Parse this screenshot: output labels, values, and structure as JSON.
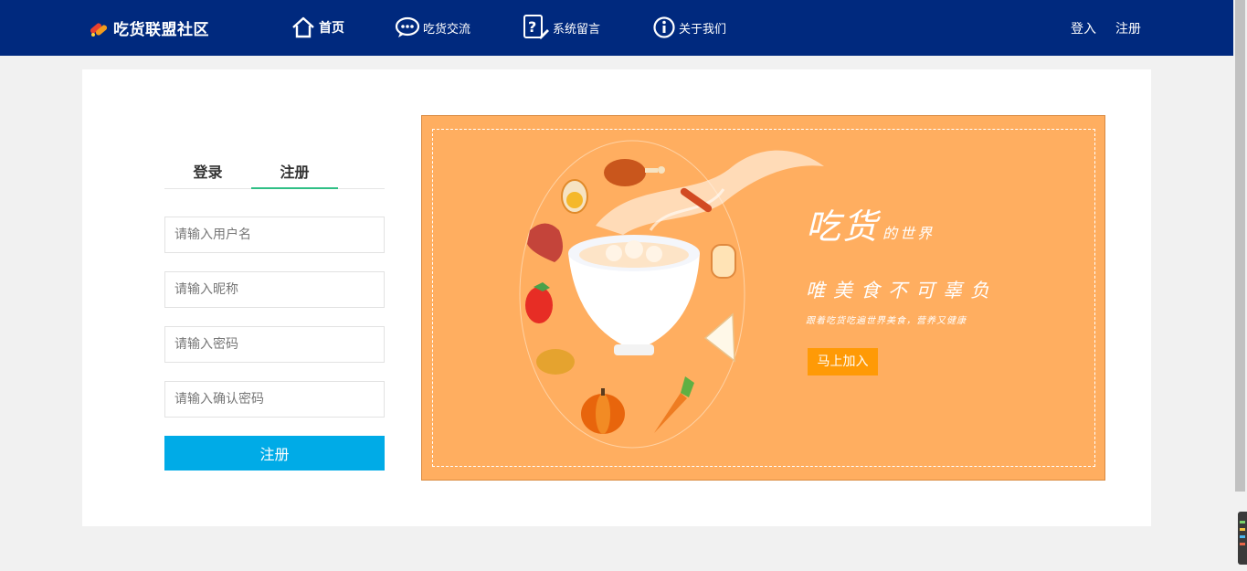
{
  "header": {
    "site_name": "吃货联盟社区",
    "nav": {
      "home": "首页",
      "chat": "吃货交流",
      "message": "系统留言",
      "about": "关于我们"
    },
    "login": "登入",
    "register": "注册"
  },
  "form": {
    "tabs": {
      "login": "登录",
      "register": "注册"
    },
    "active_tab": "注册",
    "fields": {
      "username_placeholder": "请输入用户名",
      "nickname_placeholder": "请输入昵称",
      "password_placeholder": "请输入密码",
      "confirm_placeholder": "请输入确认密码"
    },
    "submit_label": "注册"
  },
  "banner": {
    "title_big": "吃货",
    "title_small": "的世界",
    "slogan": "唯美食不可辜负",
    "subtitle": "跟着吃货吃遍世界美食，营养又健康",
    "cta_label": "马上加入"
  },
  "colors": {
    "header_bg": "#00297e",
    "banner_bg": "#ffae60",
    "submit_bg": "#00abe7",
    "tab_accent": "#2fbf85",
    "cta_bg": "#ff9a06"
  }
}
